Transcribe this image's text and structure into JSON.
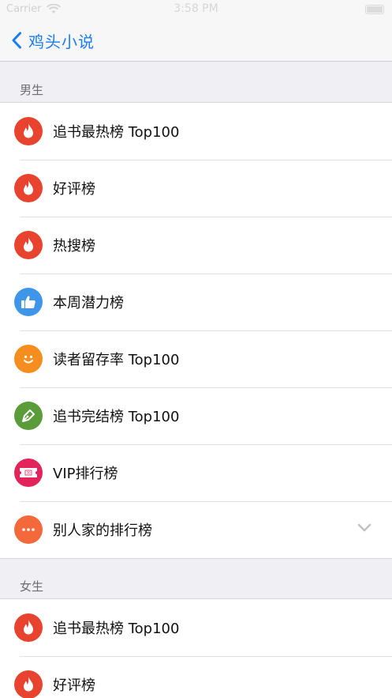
{
  "status_bar": {
    "carrier": "Carrier",
    "time": "3:58 PM"
  },
  "nav": {
    "back_label": "鸡头小说"
  },
  "sections": [
    {
      "title": "男生",
      "items": [
        {
          "label": "追书最热榜 Top100",
          "icon": "flame-icon",
          "color": "#e8432f"
        },
        {
          "label": "好评榜",
          "icon": "flame-icon",
          "color": "#e8432f"
        },
        {
          "label": "热搜榜",
          "icon": "flame-icon",
          "color": "#e8432f"
        },
        {
          "label": "本周潜力榜",
          "icon": "thumbs-up-icon",
          "color": "#3f95e8"
        },
        {
          "label": "读者留存率 Top100",
          "icon": "smiley-icon",
          "color": "#f68d1f"
        },
        {
          "label": "追书完结榜 Top100",
          "icon": "pen-nib-icon",
          "color": "#5a9c3a"
        },
        {
          "label": "VIP排行榜",
          "icon": "ticket-icon",
          "color": "#e2245a"
        },
        {
          "label": "别人家的排行榜",
          "icon": "more-dots-icon",
          "color": "#f4693b"
        }
      ]
    },
    {
      "title": "女生",
      "items": [
        {
          "label": "追书最热榜 Top100",
          "icon": "flame-icon",
          "color": "#e8432f"
        },
        {
          "label": "好评榜",
          "icon": "flame-icon",
          "color": "#e8432f"
        }
      ]
    }
  ],
  "colors": {
    "accent": "#1a7cf4",
    "background": "#efeff4"
  }
}
